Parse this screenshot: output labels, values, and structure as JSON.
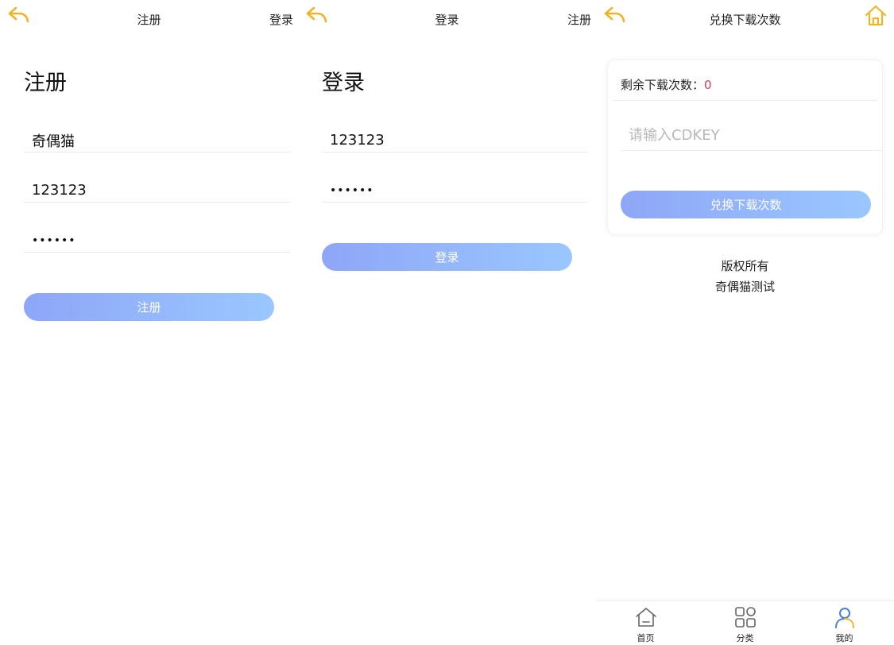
{
  "colors": {
    "accent_icon": "#f0b429",
    "button_gradient_start": "#8ea6f7",
    "button_gradient_end": "#9ac7ff",
    "count_red": "#d83a4f",
    "tab_active": "#4a7fd6"
  },
  "register_screen": {
    "topbar": {
      "back_icon": "back-arrow-icon",
      "title": "注册",
      "right_link": "登录"
    },
    "heading": "注册",
    "username_value": "奇偶猫",
    "phone_value": "123123",
    "password_value": "123123",
    "submit_label": "注册"
  },
  "login_screen": {
    "topbar": {
      "back_icon": "back-arrow-icon",
      "title": "登录",
      "right_link": "注册"
    },
    "heading": "登录",
    "username_value": "123123",
    "password_value": "123123",
    "submit_label": "登录"
  },
  "redeem_screen": {
    "topbar": {
      "back_icon": "back-arrow-icon",
      "title": "兑换下载次数",
      "home_icon": "home-icon"
    },
    "remain_label": "剩余下载次数：",
    "remain_count": "0",
    "cdkey_placeholder": "请输入CDKEY",
    "submit_label": "兑换下载次数",
    "copyright_line1": "版权所有",
    "copyright_line2": "奇偶猫测试",
    "tabbar": [
      {
        "label": "首页",
        "icon": "home-tab-icon"
      },
      {
        "label": "分类",
        "icon": "category-grid-icon"
      },
      {
        "label": "我的",
        "icon": "user-profile-icon",
        "active": true
      }
    ]
  }
}
